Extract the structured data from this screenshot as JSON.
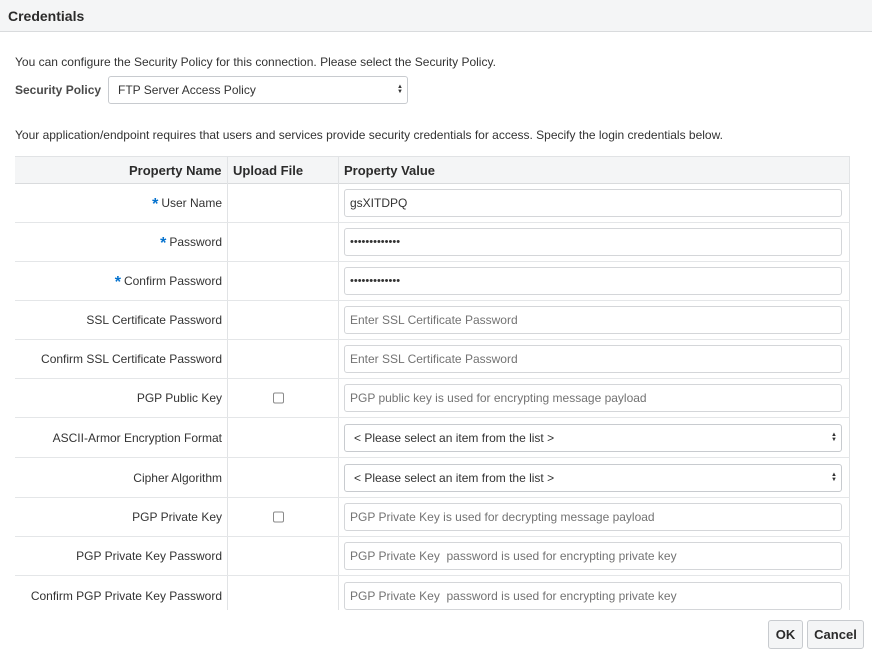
{
  "dialog": {
    "title": "Credentials"
  },
  "intro_text": "You can configure the Security Policy for this connection. Please select the Security Policy.",
  "security_policy": {
    "label": "Security Policy",
    "value": "FTP Server Access Policy"
  },
  "credentials_text": "Your application/endpoint requires that users and services provide security credentials for access. Specify the login credentials below.",
  "table": {
    "headers": {
      "property_name": "Property Name",
      "upload_file": "Upload File",
      "property_value": "Property Value"
    },
    "required_marker": "*",
    "rows": [
      {
        "name": "User Name",
        "value": "gsXITDPQ"
      },
      {
        "name": "Password",
        "value": "•••••••••••••"
      },
      {
        "name": "Confirm Password",
        "value": "•••••••••••••"
      },
      {
        "name": "SSL Certificate Password",
        "placeholder": "Enter SSL Certificate Password"
      },
      {
        "name": "Confirm SSL Certificate Password",
        "placeholder": "Enter SSL Certificate Password"
      },
      {
        "name": "PGP Public Key",
        "placeholder": "PGP public key is used for encrypting message payload"
      },
      {
        "name": "ASCII-Armor Encryption Format",
        "value": "< Please select an item from the list >"
      },
      {
        "name": "Cipher Algorithm",
        "value": "< Please select an item from the list >"
      },
      {
        "name": "PGP Private Key",
        "placeholder": "PGP Private Key is used for decrypting message payload"
      },
      {
        "name": "PGP Private Key Password",
        "placeholder": "PGP Private Key  password is used for encrypting private key"
      },
      {
        "name": "Confirm PGP Private Key Password",
        "placeholder": "PGP Private Key  password is used for encrypting private key"
      }
    ]
  },
  "buttons": {
    "ok": "OK",
    "cancel": "Cancel"
  },
  "colors": {
    "required": "#0572ce",
    "header_bg": "#f4f5f6",
    "border": "#d4d6d9"
  }
}
